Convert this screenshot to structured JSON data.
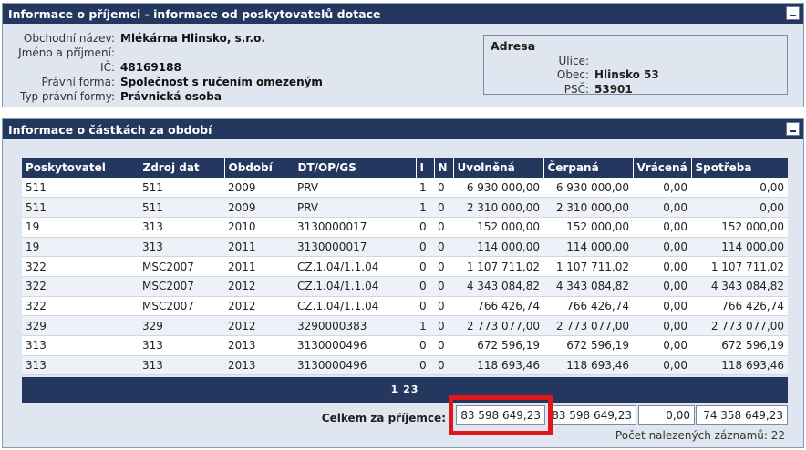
{
  "recipient_panel": {
    "title": "Informace o příjemci - informace od poskytovatelů dotace",
    "fields": [
      {
        "label": "Obchodní název:",
        "value": "Mlékárna Hlinsko, s.r.o."
      },
      {
        "label": "Jméno a příjmení:",
        "value": ""
      },
      {
        "label": "IČ:",
        "value": "48169188"
      },
      {
        "label": "Právní forma:",
        "value": "Společnost s ručením omezeným"
      },
      {
        "label": "Typ právní formy:",
        "value": "Právnická osoba"
      }
    ],
    "address": {
      "title": "Adresa",
      "fields": [
        {
          "label": "Ulice:",
          "value": ""
        },
        {
          "label": "Obec:",
          "value": "Hlinsko 53"
        },
        {
          "label": "PSČ:",
          "value": "53901"
        }
      ]
    }
  },
  "amounts_panel": {
    "title": "Informace o částkách za období",
    "columns": [
      "Poskytovatel",
      "Zdroj dat",
      "Období",
      "DT/OP/GS",
      "I",
      "N",
      "Uvolněná",
      "Čerpaná",
      "Vrácená",
      "Spotřeba"
    ],
    "rows": [
      [
        "511",
        "511",
        "2009",
        "PRV",
        "1",
        "0",
        "6 930 000,00",
        "6 930 000,00",
        "0,00",
        "0,00"
      ],
      [
        "511",
        "511",
        "2009",
        "PRV",
        "1",
        "0",
        "2 310 000,00",
        "2 310 000,00",
        "0,00",
        "0,00"
      ],
      [
        "19",
        "313",
        "2010",
        "3130000017",
        "0",
        "0",
        "152 000,00",
        "152 000,00",
        "0,00",
        "152 000,00"
      ],
      [
        "19",
        "313",
        "2011",
        "3130000017",
        "0",
        "0",
        "114 000,00",
        "114 000,00",
        "0,00",
        "114 000,00"
      ],
      [
        "322",
        "MSC2007",
        "2011",
        "CZ.1.04/1.1.04",
        "0",
        "0",
        "1 107 711,02",
        "1 107 711,02",
        "0,00",
        "1 107 711,02"
      ],
      [
        "322",
        "MSC2007",
        "2012",
        "CZ.1.04/1.1.04",
        "0",
        "0",
        "4 343 084,82",
        "4 343 084,82",
        "0,00",
        "4 343 084,82"
      ],
      [
        "322",
        "MSC2007",
        "2012",
        "CZ.1.04/1.1.04",
        "0",
        "0",
        "766 426,74",
        "766 426,74",
        "0,00",
        "766 426,74"
      ],
      [
        "329",
        "329",
        "2012",
        "3290000383",
        "1",
        "0",
        "2 773 077,00",
        "2 773 077,00",
        "0,00",
        "2 773 077,00"
      ],
      [
        "313",
        "313",
        "2013",
        "3130000496",
        "0",
        "0",
        "672 596,19",
        "672 596,19",
        "0,00",
        "672 596,19"
      ],
      [
        "313",
        "313",
        "2013",
        "3130000496",
        "0",
        "0",
        "118 693,46",
        "118 693,46",
        "0,00",
        "118 693,46"
      ]
    ],
    "pages": [
      "1",
      "2",
      "3"
    ],
    "total_label": "Celkem za příjemce:",
    "totals": {
      "uvolnena": "83 598 649,23",
      "cerpana": "83 598 649,23",
      "vracena": "0,00",
      "spotreba": "74 358 649,23"
    },
    "records_count": "Počet nalezených záznamů: 22"
  },
  "colors": {
    "header_bg": "#24375e",
    "panel_bg": "#dfe6f0",
    "highlight": "#e0161b"
  }
}
